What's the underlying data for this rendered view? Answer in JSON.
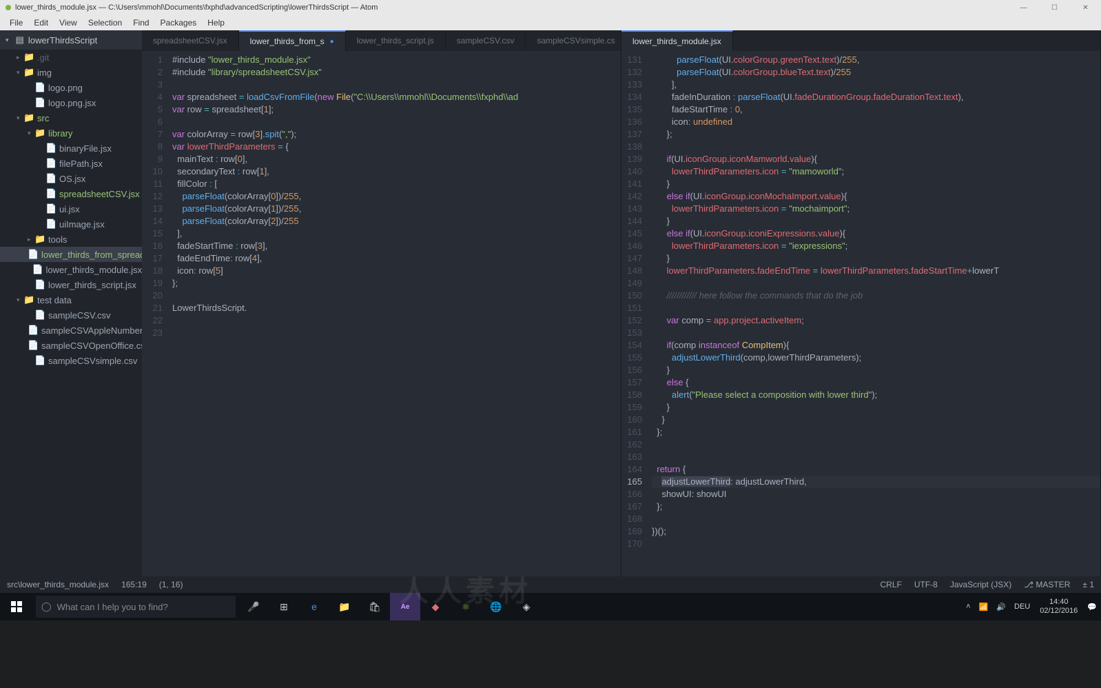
{
  "window": {
    "title": "lower_thirds_module.jsx — C:\\Users\\mmohl\\Documents\\fxphd\\advancedScripting\\lowerThirdsScript — Atom"
  },
  "menu": [
    "File",
    "Edit",
    "View",
    "Selection",
    "Find",
    "Packages",
    "Help"
  ],
  "tree": {
    "root": "lowerThirdsScript",
    "items": [
      {
        "indent": 1,
        "type": "folder-closed",
        "name": ".git",
        "dim": true
      },
      {
        "indent": 1,
        "type": "folder-open",
        "name": "img"
      },
      {
        "indent": 2,
        "type": "file",
        "name": "logo.png"
      },
      {
        "indent": 2,
        "type": "file",
        "name": "logo.png.jsx"
      },
      {
        "indent": 1,
        "type": "folder-open",
        "name": "src",
        "green": true
      },
      {
        "indent": 2,
        "type": "folder-open",
        "name": "library",
        "green": true
      },
      {
        "indent": 3,
        "type": "file",
        "name": "binaryFile.jsx"
      },
      {
        "indent": 3,
        "type": "file",
        "name": "filePath.jsx"
      },
      {
        "indent": 3,
        "type": "file",
        "name": "OS.jsx"
      },
      {
        "indent": 3,
        "type": "file",
        "name": "spreadsheetCSV.jsx",
        "green": true
      },
      {
        "indent": 3,
        "type": "file",
        "name": "ui.jsx"
      },
      {
        "indent": 3,
        "type": "file",
        "name": "uiImage.jsx"
      },
      {
        "indent": 2,
        "type": "folder-closed",
        "name": "tools"
      },
      {
        "indent": 2,
        "type": "file",
        "name": "lower_thirds_from_spreadshe",
        "green": true,
        "selected": true
      },
      {
        "indent": 2,
        "type": "file",
        "name": "lower_thirds_module.jsx"
      },
      {
        "indent": 2,
        "type": "file",
        "name": "lower_thirds_script.jsx"
      },
      {
        "indent": 1,
        "type": "folder-open",
        "name": "test data"
      },
      {
        "indent": 2,
        "type": "file",
        "name": "sampleCSV.csv"
      },
      {
        "indent": 2,
        "type": "file",
        "name": "sampleCSVAppleNumbers.cs"
      },
      {
        "indent": 2,
        "type": "file",
        "name": "sampleCSVOpenOffice.csv"
      },
      {
        "indent": 2,
        "type": "file",
        "name": "sampleCSVsimple.csv"
      }
    ]
  },
  "leftTabs": [
    {
      "label": "spreadsheetCSV.jsx",
      "active": false
    },
    {
      "label": "lower_thirds_from_s",
      "active": true,
      "modified": true
    },
    {
      "label": "lower_thirds_script.js",
      "active": false
    },
    {
      "label": "sampleCSV.csv",
      "active": false
    },
    {
      "label": "sampleCSVsimple.cs",
      "active": false
    }
  ],
  "rightTabs": [
    {
      "label": "lower_thirds_module.jsx",
      "active": true
    }
  ],
  "leftCode": {
    "start": 1,
    "lines": [
      [
        [
          "s-plain",
          "#include "
        ],
        [
          "s-string",
          "\"lower_thirds_module.jsx\""
        ]
      ],
      [
        [
          "s-plain",
          "#include "
        ],
        [
          "s-string",
          "\"library/spreadsheetCSV.jsx\""
        ]
      ],
      [],
      [
        [
          "s-keyword",
          "var"
        ],
        [
          "s-plain",
          " spreadsheet "
        ],
        [
          "s-op",
          "="
        ],
        [
          "s-plain",
          " "
        ],
        [
          "s-func",
          "loadCsvFromFile"
        ],
        [
          "s-plain",
          "("
        ],
        [
          "s-keyword",
          "new"
        ],
        [
          "s-plain",
          " "
        ],
        [
          "s-type",
          "File"
        ],
        [
          "s-plain",
          "("
        ],
        [
          "s-string",
          "\"C:\\\\Users\\\\mmohl\\\\Documents\\\\fxphd\\\\ad"
        ]
      ],
      [
        [
          "s-keyword",
          "var"
        ],
        [
          "s-plain",
          " row "
        ],
        [
          "s-op",
          "="
        ],
        [
          "s-plain",
          " spreadsheet["
        ],
        [
          "s-num",
          "1"
        ],
        [
          "s-plain",
          "];"
        ]
      ],
      [],
      [
        [
          "s-keyword",
          "var"
        ],
        [
          "s-plain",
          " colorArray "
        ],
        [
          "s-op",
          "="
        ],
        [
          "s-plain",
          " row["
        ],
        [
          "s-num",
          "3"
        ],
        [
          "s-plain",
          "]."
        ],
        [
          "s-func",
          "spit"
        ],
        [
          "s-plain",
          "("
        ],
        [
          "s-string",
          "\",\""
        ],
        [
          "s-plain",
          ");"
        ]
      ],
      [
        [
          "s-keyword",
          "var"
        ],
        [
          "s-plain",
          " "
        ],
        [
          "s-prop",
          "lowerThirdParameters"
        ],
        [
          "s-plain",
          " "
        ],
        [
          "s-op",
          "="
        ],
        [
          "s-plain",
          " {"
        ]
      ],
      [
        [
          "s-plain",
          "  mainText "
        ],
        [
          "s-op",
          ":"
        ],
        [
          "s-plain",
          " row["
        ],
        [
          "s-num",
          "0"
        ],
        [
          "s-plain",
          "],"
        ]
      ],
      [
        [
          "s-plain",
          "  secondaryText "
        ],
        [
          "s-op",
          ":"
        ],
        [
          "s-plain",
          " row["
        ],
        [
          "s-num",
          "1"
        ],
        [
          "s-plain",
          "],"
        ]
      ],
      [
        [
          "s-plain",
          "  fillColor "
        ],
        [
          "s-op",
          ":"
        ],
        [
          "s-plain",
          " ["
        ]
      ],
      [
        [
          "s-plain",
          "    "
        ],
        [
          "s-func",
          "parseFloat"
        ],
        [
          "s-plain",
          "(colorArray["
        ],
        [
          "s-num",
          "0"
        ],
        [
          "s-plain",
          "])/"
        ],
        [
          "s-num",
          "255"
        ],
        [
          "s-plain",
          ","
        ]
      ],
      [
        [
          "s-plain",
          "    "
        ],
        [
          "s-func",
          "parseFloat"
        ],
        [
          "s-plain",
          "(colorArray["
        ],
        [
          "s-num",
          "1"
        ],
        [
          "s-plain",
          "])/"
        ],
        [
          "s-num",
          "255"
        ],
        [
          "s-plain",
          ","
        ]
      ],
      [
        [
          "s-plain",
          "    "
        ],
        [
          "s-func",
          "parseFloat"
        ],
        [
          "s-plain",
          "(colorArray["
        ],
        [
          "s-num",
          "2"
        ],
        [
          "s-plain",
          "])/"
        ],
        [
          "s-num",
          "255"
        ]
      ],
      [
        [
          "s-plain",
          "  ],"
        ]
      ],
      [
        [
          "s-plain",
          "  fadeStartTime "
        ],
        [
          "s-op",
          ":"
        ],
        [
          "s-plain",
          " row["
        ],
        [
          "s-num",
          "3"
        ],
        [
          "s-plain",
          "],"
        ]
      ],
      [
        [
          "s-plain",
          "  fadeEndTime"
        ],
        [
          "s-op",
          ":"
        ],
        [
          "s-plain",
          " row["
        ],
        [
          "s-num",
          "4"
        ],
        [
          "s-plain",
          "],"
        ]
      ],
      [
        [
          "s-plain",
          "  icon"
        ],
        [
          "s-op",
          ":"
        ],
        [
          "s-plain",
          " row["
        ],
        [
          "s-num",
          "5"
        ],
        [
          "s-plain",
          "]"
        ]
      ],
      [
        [
          "s-plain",
          "};"
        ]
      ],
      [],
      [
        [
          "s-plain",
          "LowerThirdsScript."
        ]
      ],
      [],
      []
    ],
    "cursor": {
      "line": 20,
      "afterText": "        "
    }
  },
  "rightCode": {
    "start": 131,
    "lines": [
      [
        [
          "s-plain",
          "          "
        ],
        [
          "s-func",
          "parseFloat"
        ],
        [
          "s-plain",
          "(UI."
        ],
        [
          "s-prop",
          "colorGroup"
        ],
        [
          "s-plain",
          "."
        ],
        [
          "s-prop",
          "greenText"
        ],
        [
          "s-plain",
          "."
        ],
        [
          "s-prop",
          "text"
        ],
        [
          "s-plain",
          ")/"
        ],
        [
          "s-num",
          "255"
        ],
        [
          "s-plain",
          ","
        ]
      ],
      [
        [
          "s-plain",
          "          "
        ],
        [
          "s-func",
          "parseFloat"
        ],
        [
          "s-plain",
          "(UI."
        ],
        [
          "s-prop",
          "colorGroup"
        ],
        [
          "s-plain",
          "."
        ],
        [
          "s-prop",
          "blueText"
        ],
        [
          "s-plain",
          "."
        ],
        [
          "s-prop",
          "text"
        ],
        [
          "s-plain",
          ")/"
        ],
        [
          "s-num",
          "255"
        ]
      ],
      [
        [
          "s-plain",
          "        ],"
        ]
      ],
      [
        [
          "s-plain",
          "        fadeInDuration "
        ],
        [
          "s-op",
          ":"
        ],
        [
          "s-plain",
          " "
        ],
        [
          "s-func",
          "parseFloat"
        ],
        [
          "s-plain",
          "(UI."
        ],
        [
          "s-prop",
          "fadeDurationGroup"
        ],
        [
          "s-plain",
          "."
        ],
        [
          "s-prop",
          "fadeDurationText"
        ],
        [
          "s-plain",
          "."
        ],
        [
          "s-prop",
          "text"
        ],
        [
          "s-plain",
          "),"
        ]
      ],
      [
        [
          "s-plain",
          "        fadeStartTime "
        ],
        [
          "s-op",
          ":"
        ],
        [
          "s-plain",
          " "
        ],
        [
          "s-num",
          "0"
        ],
        [
          "s-plain",
          ","
        ]
      ],
      [
        [
          "s-plain",
          "        icon"
        ],
        [
          "s-op",
          ":"
        ],
        [
          "s-plain",
          " "
        ],
        [
          "s-const",
          "undefined"
        ]
      ],
      [
        [
          "s-plain",
          "      };"
        ]
      ],
      [],
      [
        [
          "s-plain",
          "      "
        ],
        [
          "s-keyword",
          "if"
        ],
        [
          "s-plain",
          "(UI."
        ],
        [
          "s-prop",
          "iconGroup"
        ],
        [
          "s-plain",
          "."
        ],
        [
          "s-prop",
          "iconMamworld"
        ],
        [
          "s-plain",
          "."
        ],
        [
          "s-prop",
          "value"
        ],
        [
          "s-plain",
          "){"
        ]
      ],
      [
        [
          "s-plain",
          "        "
        ],
        [
          "s-prop",
          "lowerThirdParameters"
        ],
        [
          "s-plain",
          "."
        ],
        [
          "s-prop",
          "icon"
        ],
        [
          "s-plain",
          " "
        ],
        [
          "s-op",
          "="
        ],
        [
          "s-plain",
          " "
        ],
        [
          "s-string",
          "\"mamoworld\""
        ],
        [
          "s-plain",
          ";"
        ]
      ],
      [
        [
          "s-plain",
          "      }"
        ]
      ],
      [
        [
          "s-plain",
          "      "
        ],
        [
          "s-keyword",
          "else if"
        ],
        [
          "s-plain",
          "(UI."
        ],
        [
          "s-prop",
          "iconGroup"
        ],
        [
          "s-plain",
          "."
        ],
        [
          "s-prop",
          "iconMochaImport"
        ],
        [
          "s-plain",
          "."
        ],
        [
          "s-prop",
          "value"
        ],
        [
          "s-plain",
          "){"
        ]
      ],
      [
        [
          "s-plain",
          "        "
        ],
        [
          "s-prop",
          "lowerThirdParameters"
        ],
        [
          "s-plain",
          "."
        ],
        [
          "s-prop",
          "icon"
        ],
        [
          "s-plain",
          " "
        ],
        [
          "s-op",
          "="
        ],
        [
          "s-plain",
          " "
        ],
        [
          "s-string",
          "\"mochaimport\""
        ],
        [
          "s-plain",
          ";"
        ]
      ],
      [
        [
          "s-plain",
          "      }"
        ]
      ],
      [
        [
          "s-plain",
          "      "
        ],
        [
          "s-keyword",
          "else if"
        ],
        [
          "s-plain",
          "(UI."
        ],
        [
          "s-prop",
          "iconGroup"
        ],
        [
          "s-plain",
          "."
        ],
        [
          "s-prop",
          "iconiExpressions"
        ],
        [
          "s-plain",
          "."
        ],
        [
          "s-prop",
          "value"
        ],
        [
          "s-plain",
          "){"
        ]
      ],
      [
        [
          "s-plain",
          "        "
        ],
        [
          "s-prop",
          "lowerThirdParameters"
        ],
        [
          "s-plain",
          "."
        ],
        [
          "s-prop",
          "icon"
        ],
        [
          "s-plain",
          " "
        ],
        [
          "s-op",
          "="
        ],
        [
          "s-plain",
          " "
        ],
        [
          "s-string",
          "\"iexpressions\""
        ],
        [
          "s-plain",
          ";"
        ]
      ],
      [
        [
          "s-plain",
          "      }"
        ]
      ],
      [
        [
          "s-plain",
          "      "
        ],
        [
          "s-prop",
          "lowerThirdParameters"
        ],
        [
          "s-plain",
          "."
        ],
        [
          "s-prop",
          "fadeEndTime"
        ],
        [
          "s-plain",
          " "
        ],
        [
          "s-op",
          "="
        ],
        [
          "s-plain",
          " "
        ],
        [
          "s-prop",
          "lowerThirdParameters"
        ],
        [
          "s-plain",
          "."
        ],
        [
          "s-prop",
          "fadeStartTime"
        ],
        [
          "s-op",
          "+"
        ],
        [
          "s-plain",
          "lowerT"
        ]
      ],
      [],
      [
        [
          "s-plain",
          "      "
        ],
        [
          "s-comment",
          "//////////// here follow the commands that do the job"
        ]
      ],
      [],
      [
        [
          "s-plain",
          "      "
        ],
        [
          "s-keyword",
          "var"
        ],
        [
          "s-plain",
          " comp "
        ],
        [
          "s-op",
          "="
        ],
        [
          "s-plain",
          " "
        ],
        [
          "s-prop",
          "app"
        ],
        [
          "s-plain",
          "."
        ],
        [
          "s-prop",
          "project"
        ],
        [
          "s-plain",
          "."
        ],
        [
          "s-prop",
          "activeItem"
        ],
        [
          "s-plain",
          ";"
        ]
      ],
      [],
      [
        [
          "s-plain",
          "      "
        ],
        [
          "s-keyword",
          "if"
        ],
        [
          "s-plain",
          "(comp "
        ],
        [
          "s-keyword",
          "instanceof"
        ],
        [
          "s-plain",
          " "
        ],
        [
          "s-type",
          "CompItem"
        ],
        [
          "s-plain",
          "){"
        ]
      ],
      [
        [
          "s-plain",
          "        "
        ],
        [
          "s-func",
          "adjustLowerThird"
        ],
        [
          "s-plain",
          "(comp,lowerThirdParameters);"
        ]
      ],
      [
        [
          "s-plain",
          "      }"
        ]
      ],
      [
        [
          "s-plain",
          "      "
        ],
        [
          "s-keyword",
          "else"
        ],
        [
          "s-plain",
          " {"
        ]
      ],
      [
        [
          "s-plain",
          "        "
        ],
        [
          "s-func",
          "alert"
        ],
        [
          "s-plain",
          "("
        ],
        [
          "s-string",
          "\"Please select a composition with lower third\""
        ],
        [
          "s-plain",
          ");"
        ]
      ],
      [
        [
          "s-plain",
          "      }"
        ]
      ],
      [
        [
          "s-plain",
          "    }"
        ]
      ],
      [
        [
          "s-plain",
          "  };"
        ]
      ],
      [],
      [],
      [
        [
          "s-plain",
          "  "
        ],
        [
          "s-keyword",
          "return"
        ],
        [
          "s-plain",
          " {"
        ]
      ],
      [
        [
          "s-plain",
          "    "
        ],
        [
          "s-hi",
          "adjustLowerThird"
        ],
        [
          "s-plain",
          ": adjustLowerThird,"
        ]
      ],
      [
        [
          "s-plain",
          "    showUI: showUI"
        ]
      ],
      [
        [
          "s-plain",
          "  };"
        ]
      ],
      [],
      [
        [
          "s-plain",
          "})();"
        ]
      ],
      []
    ],
    "currentLine": 165
  },
  "status": {
    "path": "src\\lower_thirds_module.jsx",
    "pos1": "165:19",
    "pos2": "(1, 16)",
    "crlf": "CRLF",
    "encoding": "UTF-8",
    "lang": "JavaScript (JSX)",
    "branch": "MASTER",
    "changes": "1"
  },
  "taskbar": {
    "searchPlaceholder": "What can I help you to find?",
    "lang": "DEU",
    "time": "14:40",
    "date": "02/12/2016"
  },
  "watermark": "人人素材"
}
